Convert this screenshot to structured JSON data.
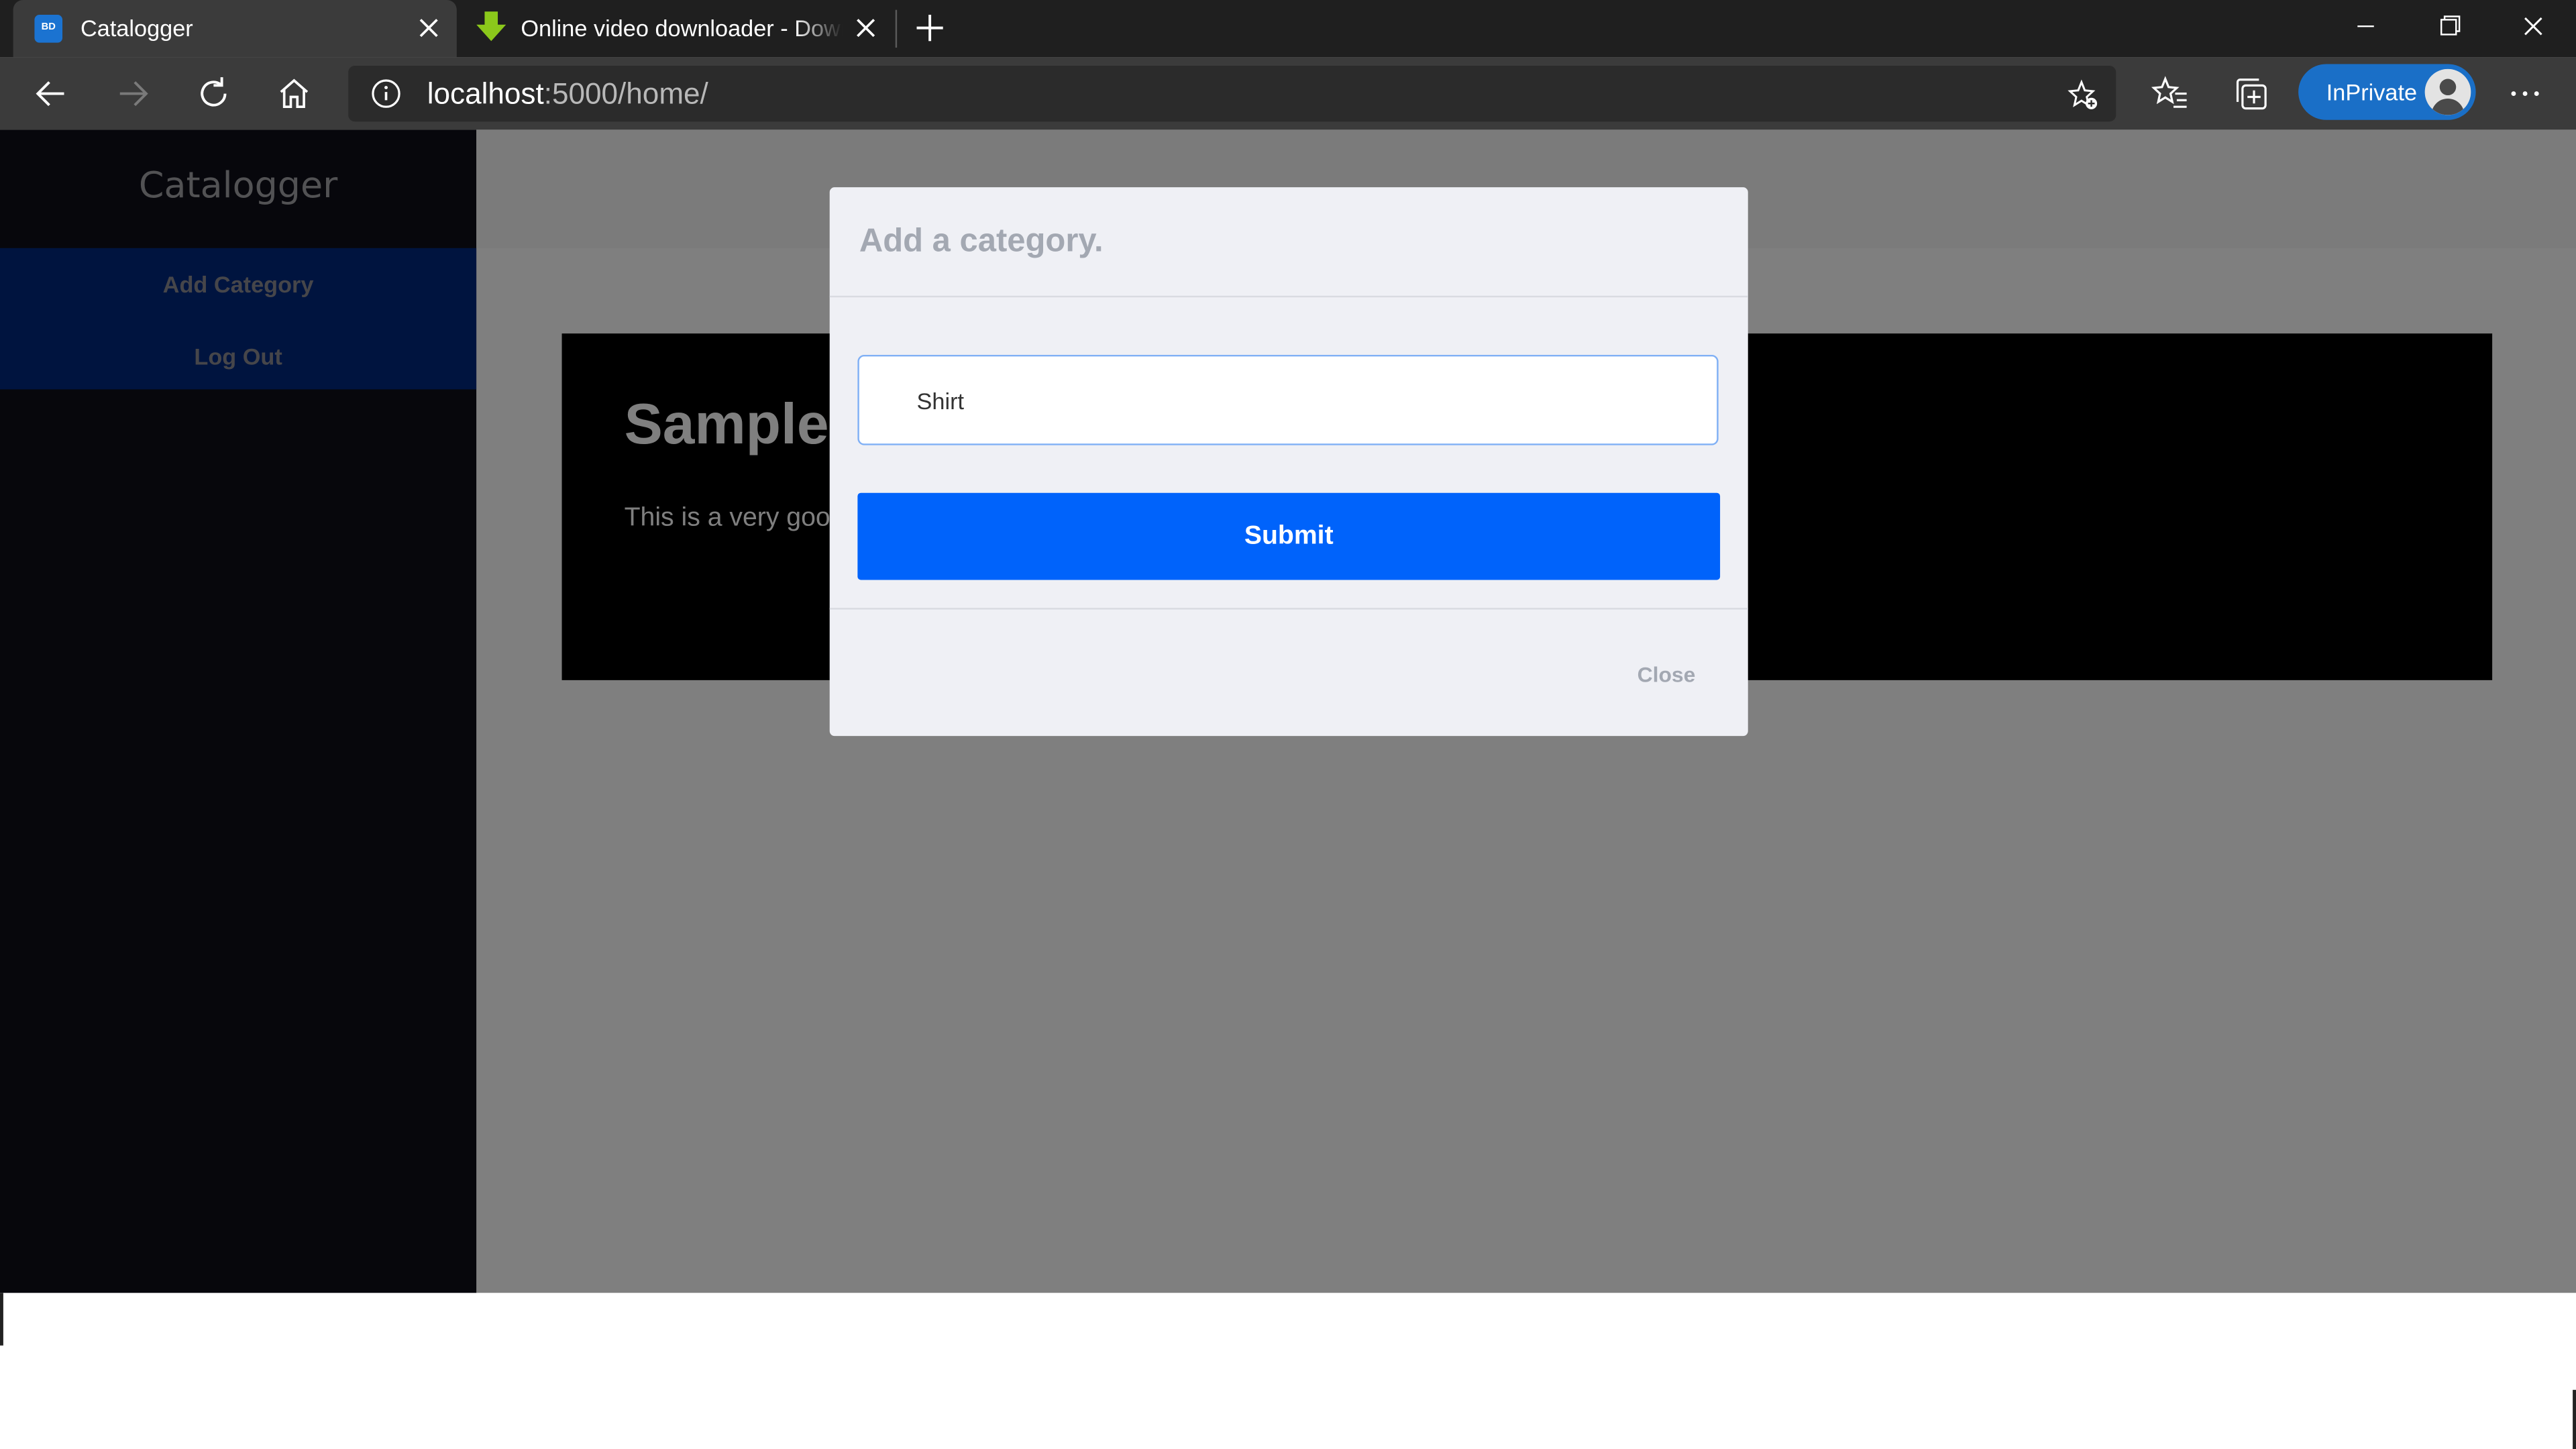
{
  "browser": {
    "tabs": [
      {
        "title": "Catalogger",
        "favicon": "BD"
      },
      {
        "title": "Online video downloader - Download",
        "favicon": "download-arrow-icon"
      }
    ],
    "address": {
      "host": "localhost",
      "path": ":5000/home/"
    },
    "inprivate_label": "InPrivate"
  },
  "sidebar": {
    "brand": "Catalogger",
    "items": [
      {
        "label": "Add Category"
      },
      {
        "label": "Log Out"
      }
    ]
  },
  "main": {
    "hero_title": "Sample Category",
    "hero_text": "This is a very good category."
  },
  "modal": {
    "title": "Add a category.",
    "input_value": "Shirt",
    "submit_label": "Submit",
    "close_label": "Close"
  },
  "colors": {
    "accent": "#0063fb",
    "sidebar_bg": "#0f0f19",
    "sidebar_nav_bg": "#00287f",
    "inprivate": "#1a6fc7"
  }
}
